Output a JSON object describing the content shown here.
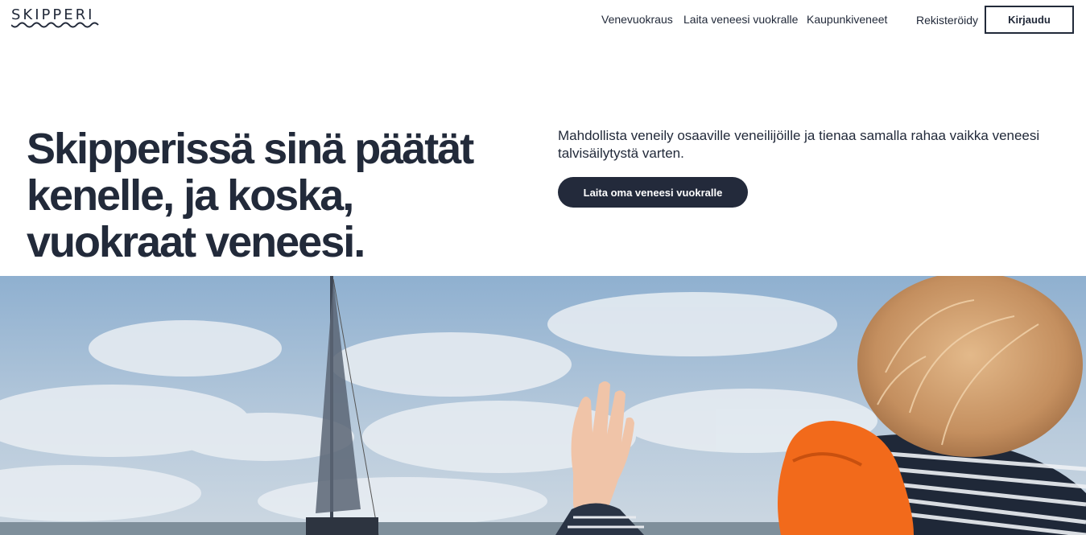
{
  "brand": {
    "name": "SKIPPERI"
  },
  "nav": {
    "items": [
      {
        "label": "Venevuokraus"
      },
      {
        "label": "Laita veneesi vuokralle"
      },
      {
        "label": "Kaupunkiveneet"
      }
    ],
    "register_label": "Rekisteröidy",
    "login_label": "Kirjaudu"
  },
  "hero": {
    "title_lines": [
      "Skipperissä sinä päätät",
      "kenelle, ja koska,",
      "vuokraat veneesi."
    ],
    "description": "Mahdollista veneily osaaville veneilijöille ja tienaa samalla rahaa vaikka veneesi talvisäilytystä varten.",
    "cta_label": "Laita oma veneesi vuokralle"
  },
  "colors": {
    "primary": "#222a3a",
    "background": "#ffffff",
    "sky": "#a9bfd6",
    "life_vest": "#f26a1b"
  },
  "photo": {
    "icon": "hero-photo-sailboat-child"
  }
}
